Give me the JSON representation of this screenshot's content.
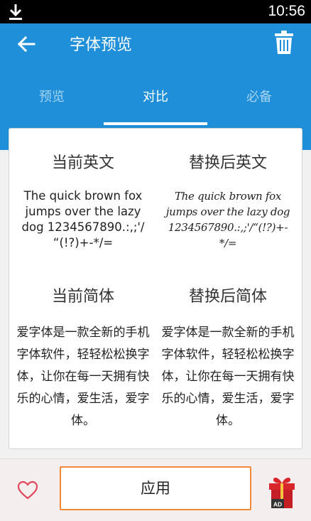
{
  "status_bar": {
    "time": "10:56"
  },
  "app_bar": {
    "title": "字体预览"
  },
  "tabs": [
    {
      "label": "预览"
    },
    {
      "label": "对比"
    },
    {
      "label": "必备"
    }
  ],
  "comparison": {
    "current_english": {
      "heading": "当前英文",
      "sample": "The quick brown fox jumps over the lazy dog 1234567890.:,;'/ “(!?)+-*/="
    },
    "replaced_english": {
      "heading": "替换后英文",
      "sample": "The quick brown fox jumps over the lazy dog 1234567890.:,;'/“(!?)+-*/="
    },
    "current_chinese": {
      "heading": "当前简体",
      "sample": "爱字体是一款全新的手机字体软件，轻轻松松换字体，让你在每一天拥有快乐的心情，爱生活，爱字体。"
    },
    "replaced_chinese": {
      "heading": "替换后简体",
      "sample": "爱字体是一款全新的手机字体软件，轻轻松松换字体，让你在每一天拥有快乐的心情，爱生活，爱字体。"
    }
  },
  "bottom": {
    "apply_label": "应用",
    "ad_badge": "AD"
  },
  "colors": {
    "primary": "#1e8fd8",
    "accent_border": "#f08a3a",
    "gift_red": "#d9262b"
  }
}
